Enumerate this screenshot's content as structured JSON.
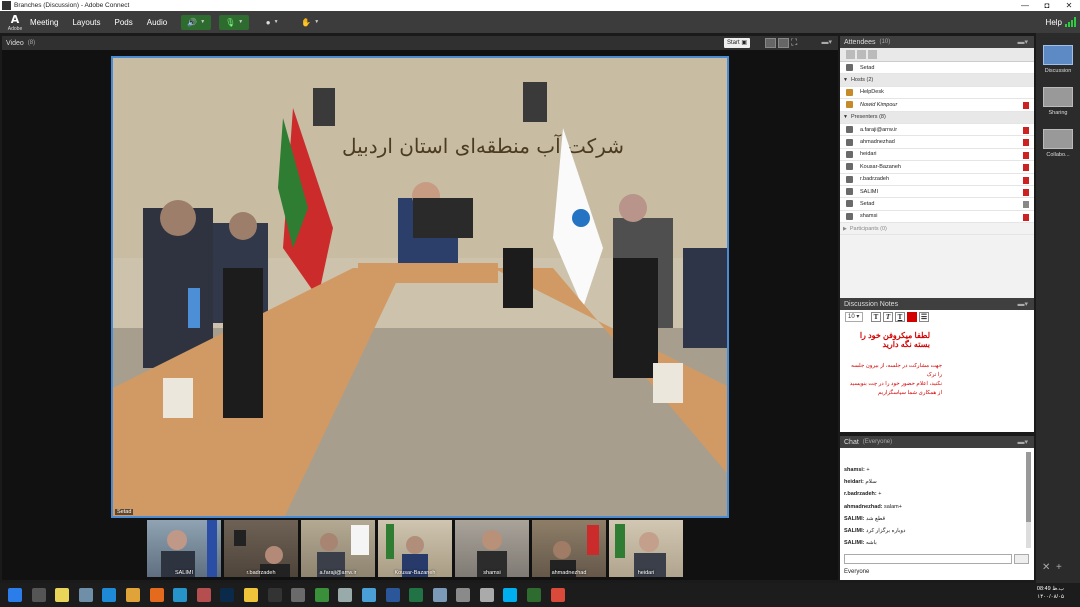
{
  "window": {
    "title": "Branches (Discussion) - Adobe Connect",
    "min": "—",
    "max": "◘",
    "close": "✕"
  },
  "menubar": {
    "logo_letter": "A",
    "logo_sub": "Adobe",
    "items": [
      "Meeting",
      "Layouts",
      "Pods",
      "Audio"
    ],
    "help": "Help",
    "mic_color": "#2ea44f",
    "voip_color": "#2ea44f"
  },
  "video_pod": {
    "title": "Video",
    "count": "(8)",
    "start": "Start",
    "main_label": "Setad",
    "thumbnails": [
      "SALIMI",
      "r.badrzadeh",
      "a.faraji@arrw.ir",
      "Kousar-Bazaneh",
      "shamsi",
      "ahmadnezhad",
      "heidari"
    ]
  },
  "attendees": {
    "title": "Attendees",
    "count": "(10)",
    "top": "Setad",
    "hosts_label": "Hosts (2)",
    "hosts": [
      "HelpDesk",
      "Nowid Kimpour"
    ],
    "presenters_label": "Presenters (8)",
    "presenters": [
      "a.faraji@arrw.ir",
      "ahmadnezhad",
      "heidari",
      "Kousar-Bazaneh",
      "r.badrzadeh",
      "SALIMI",
      "Setad",
      "shamsi"
    ],
    "participants_label": "Participants (0)"
  },
  "notes": {
    "title": "Discussion Notes",
    "font_size": "10",
    "line1": "لطفا میکروفن خود را بسته نگه دارید",
    "line2": "جهت مشارکت در جلسه، از بیرون جلسه را ترک",
    "line3": "نکنید، اعلام حضور خود را در چت بنویسید",
    "line4": "از همکاری شما سپاسگزاریم"
  },
  "chat": {
    "title": "Chat",
    "scope": "(Everyone)",
    "messages": [
      {
        "u": "shamsi:",
        "t": "+"
      },
      {
        "u": "heidari:",
        "t": "سلام"
      },
      {
        "u": "r.badrzadeh:",
        "t": "+"
      },
      {
        "u": "ahmadnezhad:",
        "t": "salam+"
      },
      {
        "u": "SALIMI:",
        "t": "قطع شد"
      },
      {
        "u": "SALIMI:",
        "t": "دوباره برگزار کرد"
      },
      {
        "u": "SALIMI:",
        "t": "باشه"
      }
    ],
    "audience": "Everyone"
  },
  "layouts": [
    "Discussion",
    "Sharing",
    "Collabo..."
  ],
  "tray": {
    "time": "08:49 ب.ظ",
    "date": "۱۴۰۰/۰۸/۰۵"
  }
}
